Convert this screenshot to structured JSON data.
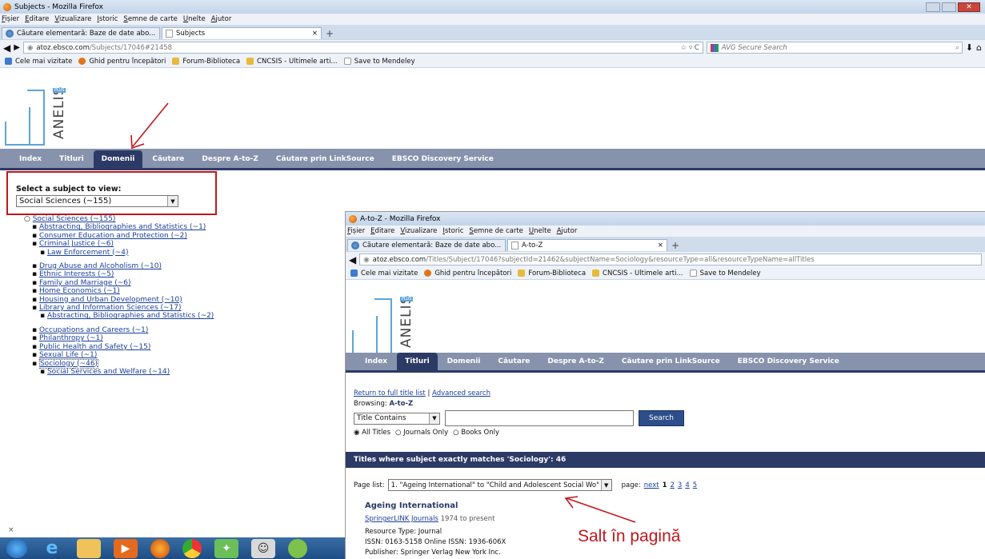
{
  "win1": {
    "title": "Subjects - Mozilla Firefox",
    "menu": [
      "Fișier",
      "Editare",
      "Vizualizare",
      "Istoric",
      "Semne de carte",
      "Unelte",
      "Ajutor"
    ],
    "tabs": [
      "Căutare elementară: Baze de date abo...",
      "Subjects"
    ],
    "url_host": "atoz.ebsco.com",
    "url_path": "/Subjects/17046#21458",
    "search_placeholder": "AVG Secure Search",
    "bookmarks": [
      "Cele mai vizitate",
      "Ghid pentru începători",
      "Forum-Biblioteca",
      "CNCSIS - Ultimele arti...",
      "Save to Mendeley"
    ],
    "logo_text": "ANELIS",
    "logo_sup": "PLUS",
    "nav": [
      "Index",
      "Titluri",
      "Domenii",
      "Căutare",
      "Despre A-to-Z",
      "Căutare prin LinkSource",
      "EBSCO Discovery Service"
    ],
    "nav_active": "Domenii",
    "select_label": "Select a subject to view:",
    "select_value": "Social Sciences (~155)",
    "tree": {
      "root": "Social Sciences (~155)",
      "items": [
        {
          "t": "Abstracting, Bibliographies and Statistics (~1)",
          "c": []
        },
        {
          "t": "Consumer Education and Protection (~2)",
          "c": []
        },
        {
          "t": "Criminal Justice (~6)",
          "c": [
            "Law Enforcement (~4)"
          ]
        },
        {
          "t": "Drug Abuse and Alcoholism (~10)",
          "c": []
        },
        {
          "t": "Ethnic Interests (~5)",
          "c": []
        },
        {
          "t": "Family and Marriage (~6)",
          "c": []
        },
        {
          "t": "Home Economics (~1)",
          "c": []
        },
        {
          "t": "Housing and Urban Development (~10)",
          "c": []
        },
        {
          "t": "Library and Information Sciences (~17)",
          "c": [
            "Abstracting, Bibliographies and Statistics (~2)"
          ]
        },
        {
          "t": "Occupations and Careers (~1)",
          "c": []
        },
        {
          "t": "Philanthropy (~1)",
          "c": []
        },
        {
          "t": "Public Health and Safety (~15)",
          "c": []
        },
        {
          "t": "Sexual Life (~1)",
          "c": []
        },
        {
          "t": "Sociology (~46)",
          "c": [
            "Social Services and Welfare (~14)"
          ]
        }
      ]
    }
  },
  "win2": {
    "title": "A-to-Z - Mozilla Firefox",
    "tabs": [
      "Căutare elementară: Baze de date abo...",
      "A-to-Z"
    ],
    "url_host": "atoz.ebsco.com",
    "url_path": "/Titles/Subject/17046?subjectId=21462&subjectName=Sociology&resourceType=all&resourceTypeName=allTitles",
    "nav_active": "Titluri",
    "return_link": "Return to full title list",
    "sep": "|",
    "advanced": "Advanced search",
    "browsing_label": "Browsing:",
    "browsing_value": "A-to-Z",
    "search_type": "Title Contains",
    "search_button": "Search",
    "radios": [
      "All Titles",
      "Journals Only",
      "Books Only"
    ],
    "banner": "Titles where subject exactly matches 'Sociology': 46",
    "page_list_label": "Page list:",
    "page_list_value": "1. \"Ageing International\" to \"Child and Adolescent Social Wo\"",
    "page_label": "page:",
    "page_next": "next",
    "page_current": "1",
    "pages": [
      "2",
      "3",
      "4",
      "5"
    ],
    "result": {
      "title": "Ageing International",
      "source": "SpringerLINK Journals",
      "coverage": "1974 to present",
      "type": "Resource Type: Journal",
      "issn": "ISSN: 0163-5158 Online ISSN: 1936-606X",
      "publisher": "Publisher: Springer Verlag New York Inc."
    }
  },
  "annotation": "Salt în pagină",
  "accent": "#c0171c"
}
